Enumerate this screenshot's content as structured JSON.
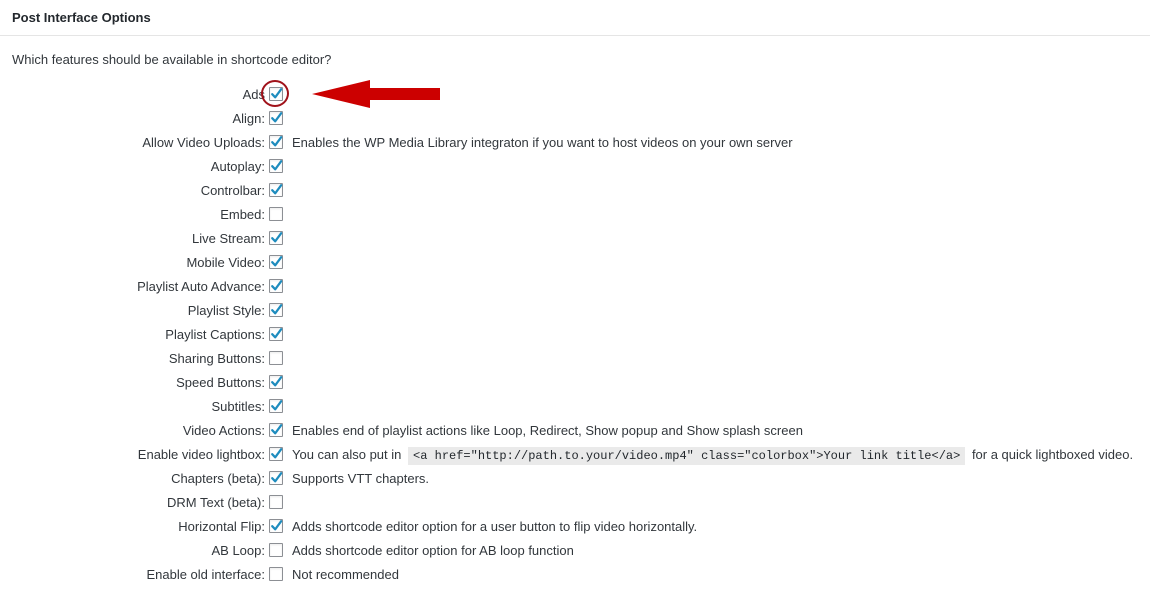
{
  "section": {
    "title": "Post Interface Options",
    "intro": "Which features should be available in shortcode editor?"
  },
  "options": [
    {
      "label": "Ads",
      "checked": true,
      "desc": ""
    },
    {
      "label": "Align:",
      "checked": true,
      "desc": ""
    },
    {
      "label": "Allow Video Uploads:",
      "checked": true,
      "desc": "Enables the WP Media Library integraton if you want to host videos on your own server"
    },
    {
      "label": "Autoplay:",
      "checked": true,
      "desc": ""
    },
    {
      "label": "Controlbar:",
      "checked": true,
      "desc": ""
    },
    {
      "label": "Embed:",
      "checked": false,
      "desc": ""
    },
    {
      "label": "Live Stream:",
      "checked": true,
      "desc": ""
    },
    {
      "label": "Mobile Video:",
      "checked": true,
      "desc": ""
    },
    {
      "label": "Playlist Auto Advance:",
      "checked": true,
      "desc": ""
    },
    {
      "label": "Playlist Style:",
      "checked": true,
      "desc": ""
    },
    {
      "label": "Playlist Captions:",
      "checked": true,
      "desc": ""
    },
    {
      "label": "Sharing Buttons:",
      "checked": false,
      "desc": ""
    },
    {
      "label": "Speed Buttons:",
      "checked": true,
      "desc": ""
    },
    {
      "label": "Subtitles:",
      "checked": true,
      "desc": ""
    },
    {
      "label": "Video Actions:",
      "checked": true,
      "desc": "Enables end of playlist actions like Loop, Redirect, Show popup and Show splash screen"
    },
    {
      "label": "Enable video lightbox:",
      "checked": true,
      "desc_before": "You can also put in",
      "code": "<a href=\"http://path.to.your/video.mp4\" class=\"colorbox\">Your link title</a>",
      "desc_after": "for a quick lightboxed video."
    },
    {
      "label": "Chapters (beta):",
      "checked": true,
      "desc": "Supports VTT chapters."
    },
    {
      "label": "DRM Text (beta):",
      "checked": false,
      "desc": ""
    },
    {
      "label": "Horizontal Flip:",
      "checked": true,
      "desc": "Adds shortcode editor option for a user button to flip video horizontally."
    },
    {
      "label": "AB Loop:",
      "checked": false,
      "desc": "Adds shortcode editor option for AB loop function"
    },
    {
      "label": "Enable old interface:",
      "checked": false,
      "desc": "Not recommended"
    }
  ],
  "colors": {
    "check": "#1e8cbe",
    "annotation": "#cc0000"
  }
}
